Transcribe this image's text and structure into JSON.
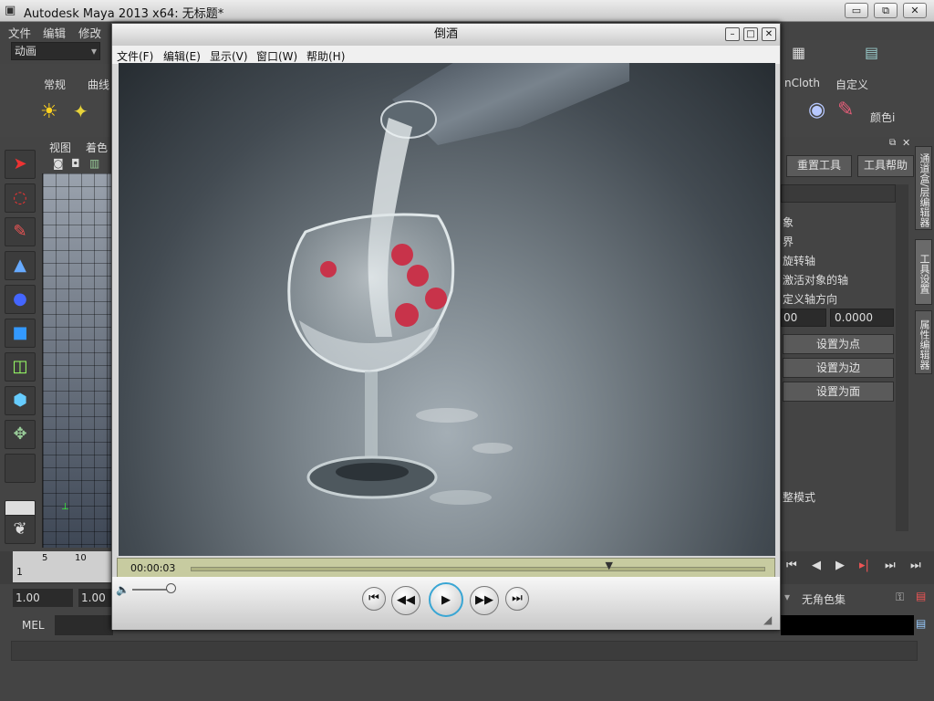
{
  "window": {
    "title": "Autodesk Maya 2013 x64: 无标题*",
    "btn_min": "▭",
    "btn_max": "⧉",
    "btn_close": "✕"
  },
  "menubar": [
    "文件",
    "编辑",
    "修改"
  ],
  "mode_dropdown": "动画",
  "shelf_tabs": {
    "tab1": "常规",
    "tab2": "曲线",
    "right1": "nCloth",
    "right2": "自定义",
    "colorlabel": "颜色i"
  },
  "viewport_menu": {
    "view": "视图",
    "shading": "着色"
  },
  "right_panel": {
    "reset_tool": "重置工具",
    "tool_help": "工具帮助",
    "lines": [
      "象",
      "界",
      "旋转轴",
      "激活对象的轴",
      "定义轴方向"
    ],
    "field1": "00",
    "field2": "0.0000",
    "btn_point": "设置为点",
    "btn_edge": "设置为边",
    "btn_face": "设置为面",
    "adjust_mode": "整模式",
    "vtab1": "通道盒/层编辑器",
    "vtab2": "工具设置",
    "vtab3": "属性编辑器"
  },
  "timeline": {
    "ticks": [
      "5",
      "10"
    ],
    "current": "1"
  },
  "range": {
    "start": "1.00",
    "start2": "1.00",
    "charset": "无角色集"
  },
  "cmdline": {
    "label": "MEL"
  },
  "player": {
    "title": "倒酒",
    "btn_min": "–",
    "btn_max": "□",
    "btn_close": "✕",
    "menu": [
      "文件(F)",
      "编辑(E)",
      "显示(V)",
      "窗口(W)",
      "帮助(H)"
    ],
    "time": "00:00:03",
    "progress": 0.73,
    "volume": 0.45
  },
  "colors": {
    "maya_bg": "#444444",
    "player_bg": "#d6d6d6",
    "seek_bg": "#c7cba0",
    "cherry": "#c8334a"
  }
}
